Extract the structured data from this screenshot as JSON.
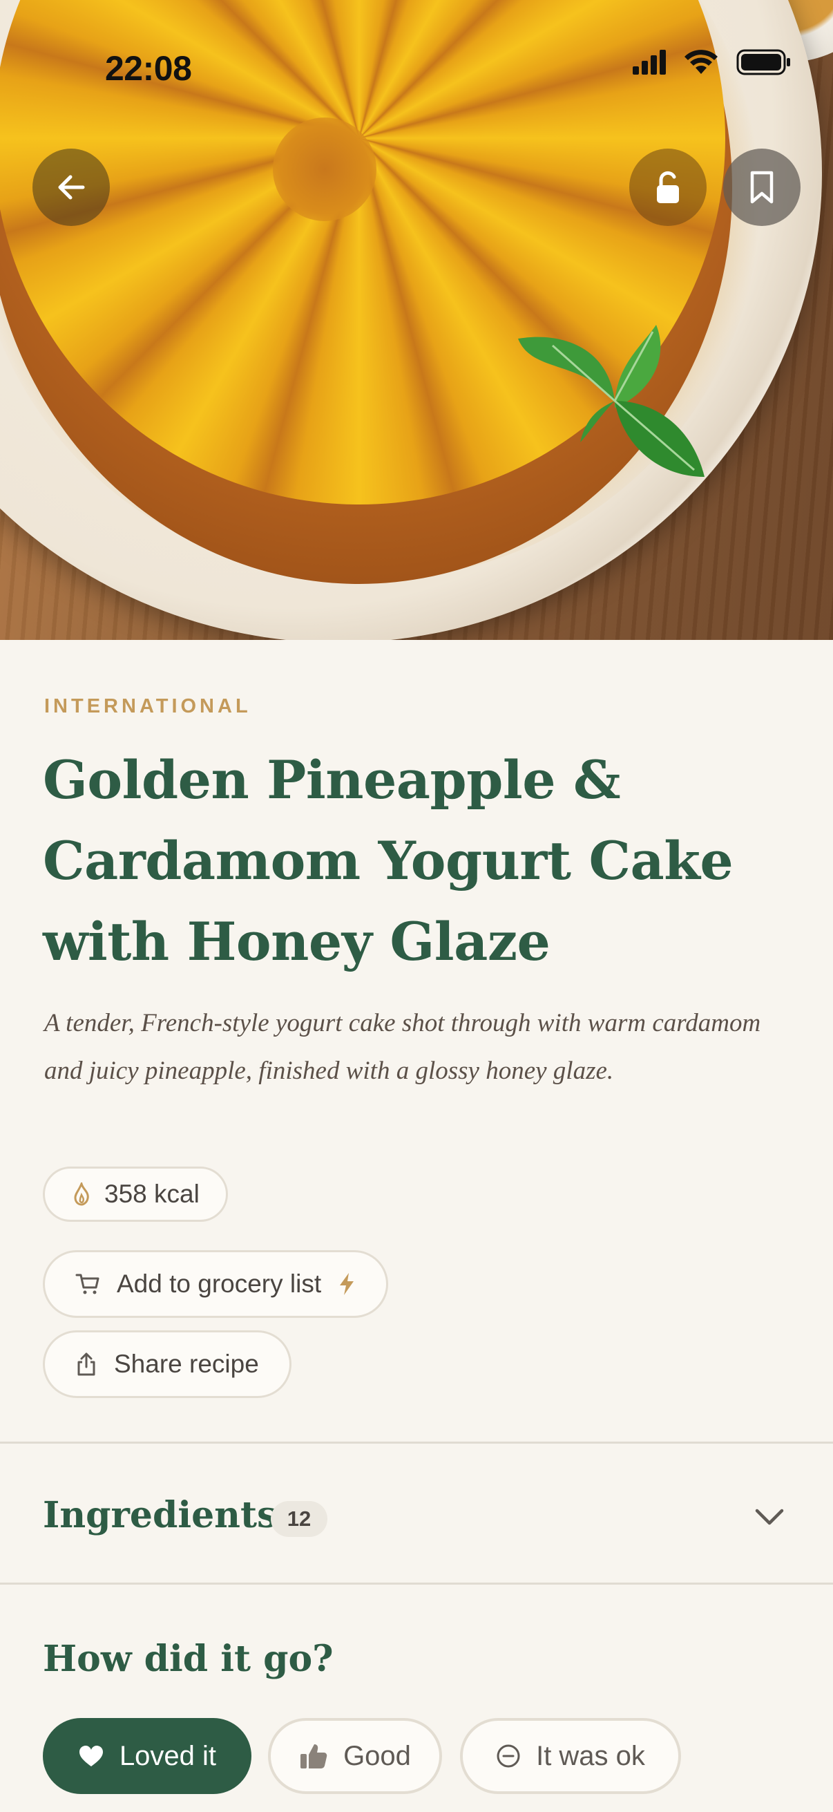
{
  "status_bar": {
    "time": "22:08"
  },
  "recipe": {
    "category": "INTERNATIONAL",
    "title_lines": [
      "Golden Pineapple &",
      "Cardamom Yogurt Cake",
      "with Honey Glaze"
    ],
    "description": "A tender, French-style yogurt cake shot through with warm cardamom and juicy pineapple, finished with a glossy honey glaze.",
    "calories": "358 kcal"
  },
  "actions": {
    "grocery_label": "Add to grocery list",
    "share_label": "Share recipe"
  },
  "ingredients": {
    "title": "Ingredients",
    "count": "12"
  },
  "feedback": {
    "title": "How did it go?",
    "options": [
      "Loved it",
      "Good",
      "It was ok"
    ]
  },
  "colors": {
    "accent_green": "#2e5c45",
    "category_gold": "#c49a5a",
    "background": "#f8f5ef"
  }
}
